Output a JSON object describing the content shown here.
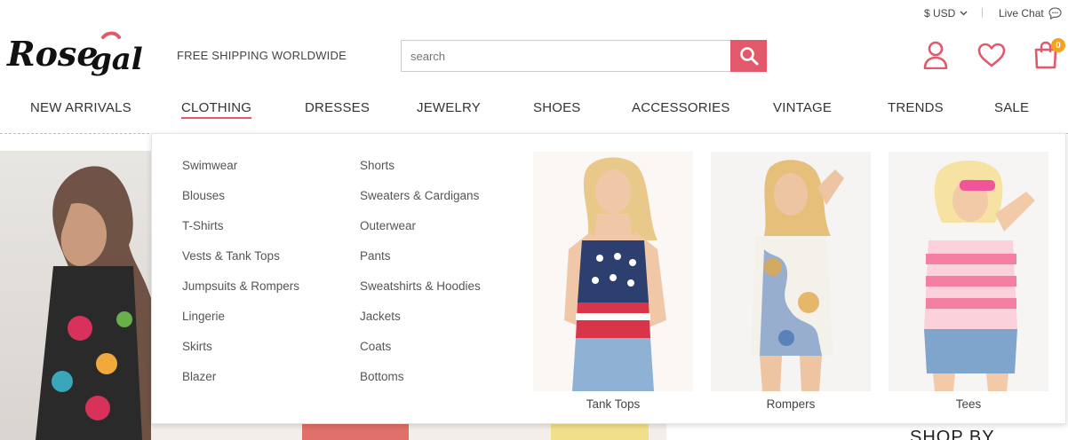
{
  "topbar": {
    "currency": "$ USD",
    "separator": "|",
    "live_chat": "Live Chat"
  },
  "header": {
    "logo_text": "Rosegal",
    "tagline": "FREE SHIPPING WORLDWIDE",
    "search_placeholder": "search",
    "cart_count": "0"
  },
  "nav": {
    "items": [
      "NEW ARRIVALS",
      "CLOTHING",
      "DRESSES",
      "JEWELRY",
      "SHOES",
      "ACCESSORIES",
      "VINTAGE",
      "TRENDS",
      "SALE"
    ],
    "active": "CLOTHING"
  },
  "dropdown": {
    "col1": [
      "Swimwear",
      "Blouses",
      "T-Shirts",
      "Vests & Tank Tops",
      "Jumpsuits & Rompers",
      "Lingerie",
      "Skirts",
      "Blazer"
    ],
    "col2": [
      "Shorts",
      "Sweaters & Cardigans",
      "Outerwear",
      "Pants",
      "Sweatshirts & Hoodies",
      "Jackets",
      "Coats",
      "Bottoms"
    ],
    "promos": [
      "Tank Tops",
      "Rompers",
      "Tees"
    ]
  },
  "hero": {
    "partial_text": "SHOP BY"
  },
  "colors": {
    "accent": "#e2596b",
    "badge": "#f7a21b"
  }
}
